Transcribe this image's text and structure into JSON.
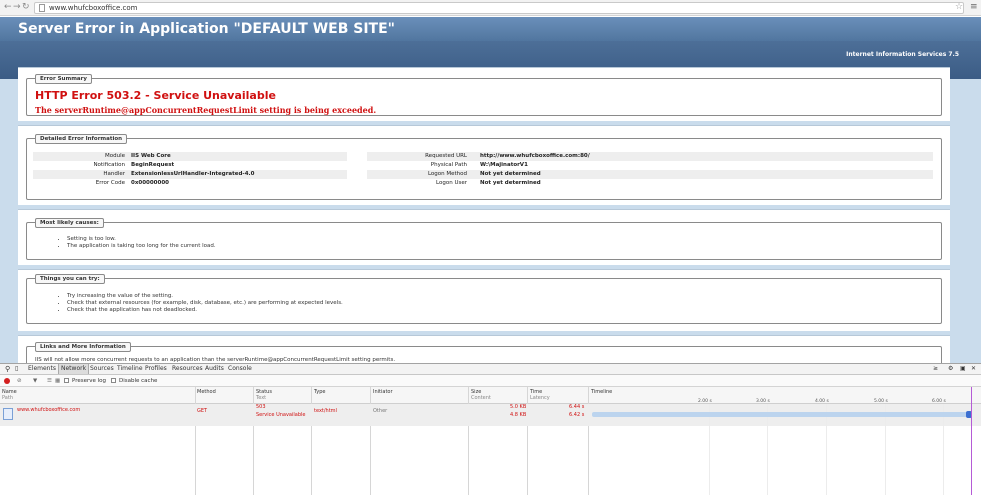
{
  "browser": {
    "url": "www.whufcboxoffice.com",
    "back_icon": "arrow-left-icon",
    "forward_icon": "arrow-right-icon",
    "reload_icon": "reload-icon",
    "star_icon": "star-icon",
    "menu_icon": "hamburger-menu-icon"
  },
  "iis": {
    "title": "Server Error in Application \"DEFAULT WEB SITE\"",
    "version": "Internet Information Services 7.5",
    "summary": {
      "legend": "Error Summary",
      "error_title": "HTTP Error 503.2 - Service Unavailable",
      "error_message": "The serverRuntime@appConcurrentRequestLimit setting is being exceeded."
    },
    "details": {
      "legend": "Detailed Error Information",
      "left": [
        {
          "label": "Module",
          "value": "IIS Web Core"
        },
        {
          "label": "Notification",
          "value": "BeginRequest"
        },
        {
          "label": "Handler",
          "value": "ExtensionlessUrlHandler-Integrated-4.0"
        },
        {
          "label": "Error Code",
          "value": "0x00000000"
        }
      ],
      "right": [
        {
          "label": "Requested URL",
          "value": "http://www.whufcboxoffice.com:80/"
        },
        {
          "label": "Physical Path",
          "value": "W:\\MajinatorV1"
        },
        {
          "label": "Logon Method",
          "value": "Not yet determined"
        },
        {
          "label": "Logon User",
          "value": "Not yet determined"
        }
      ]
    },
    "causes": {
      "legend": "Most likely causes:",
      "items": [
        "Setting is too low.",
        "The application is taking too long for the current load."
      ]
    },
    "try": {
      "legend": "Things you can try:",
      "items": [
        "Try increasing the value of the setting.",
        "Check that external resources (for example, disk, database, etc.) are performing at expected levels.",
        "Check that the application has not deadlocked."
      ]
    },
    "links": {
      "legend": "Links and More Information",
      "text": "IIS will not allow more concurrent requests to an application than the serverRuntime@appConcurrentRequestLimit setting permits."
    }
  },
  "devtools": {
    "tabs": [
      "Elements",
      "Network",
      "Sources",
      "Timeline",
      "Profiles",
      "Resources",
      "Audits",
      "Console"
    ],
    "active_tab": "Network",
    "toolbar": {
      "preserve_log": "Preserve log",
      "disable_cache": "Disable cache"
    },
    "columns": {
      "name": "Name",
      "name_sub": "Path",
      "method": "Method",
      "status": "Status",
      "status_sub": "Text",
      "type": "Type",
      "initiator": "Initiator",
      "size": "Size",
      "size_sub": "Content",
      "time": "Time",
      "time_sub": "Latency",
      "timeline": "Timeline"
    },
    "timeline_ticks": [
      "2.00 s",
      "3.00 s",
      "4.00 s",
      "5.00 s",
      "6.00 s"
    ],
    "request": {
      "name": "www.whufcboxoffice.com",
      "method": "GET",
      "status": "503",
      "status_text": "Service Unavailable",
      "type": "text/html",
      "initiator": "Other",
      "size": "5.0 KB",
      "content": "4.8 KB",
      "time": "6.44 s",
      "latency": "6.42 s"
    }
  }
}
